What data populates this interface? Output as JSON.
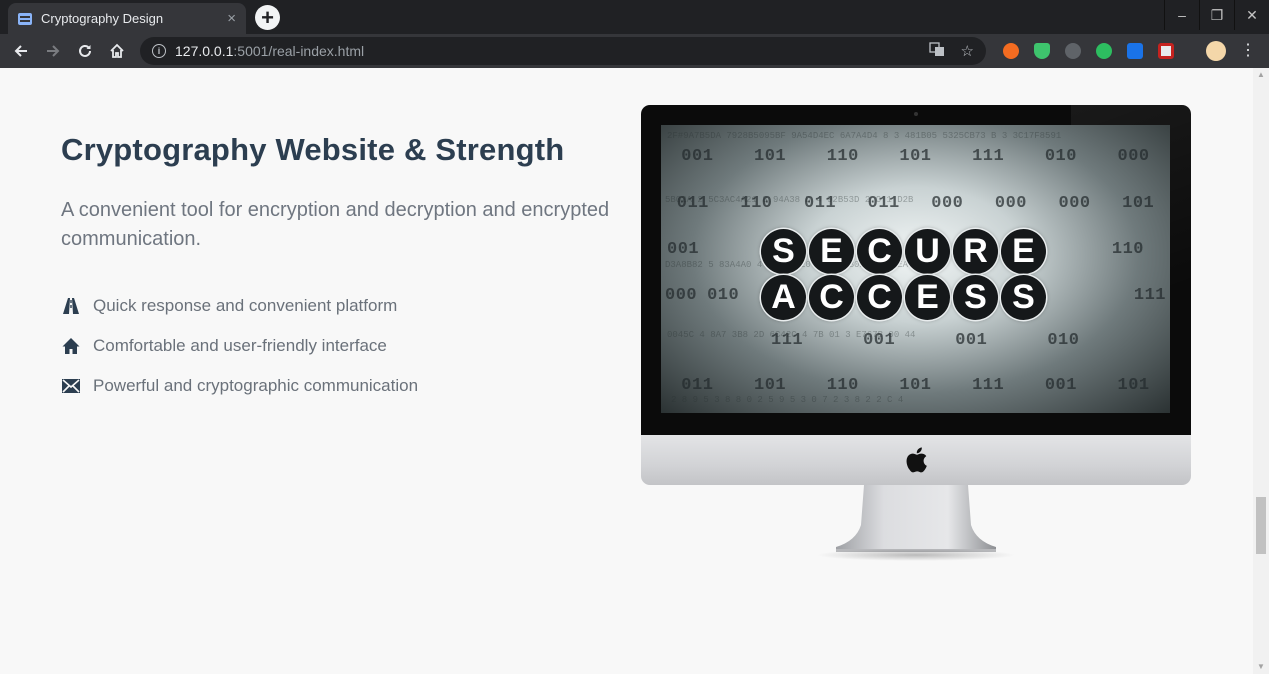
{
  "browser": {
    "tab_title": "Cryptography Design",
    "tab_close": "×",
    "new_tab": "+",
    "url_host": "127.0.0.1",
    "url_rest": ":5001/real-index.html",
    "window_controls": [
      "–",
      "❐",
      "✕"
    ]
  },
  "page": {
    "heading": "Cryptography Website & Strength",
    "lead": "A convenient tool for encryption and decryption and encrypted communication.",
    "features": [
      {
        "icon": "road-icon",
        "label": "Quick response and convenient platform"
      },
      {
        "icon": "home-icon",
        "label": "Comfortable and user-friendly interface"
      },
      {
        "icon": "envelope-icon",
        "label": "Powerful and cryptographic communication"
      }
    ],
    "hero_image": {
      "line1": [
        "S",
        "E",
        "C",
        "U",
        "R",
        "E"
      ],
      "line2": [
        "A",
        "C",
        "C",
        "E",
        "S",
        "S"
      ],
      "binary_rows": [
        [
          "001",
          "101",
          "110",
          "101",
          "111",
          "010",
          "000"
        ],
        [
          "011",
          "110",
          "011",
          "011",
          "000",
          "000",
          "000",
          "101"
        ],
        [
          "001",
          "110"
        ],
        [
          "000",
          "010",
          "111"
        ],
        [
          "111",
          "001",
          "001",
          "010"
        ],
        [
          "011",
          "101",
          "110",
          "101",
          "111",
          "001",
          "101"
        ]
      ]
    }
  },
  "colors": {
    "heading": "#2c3e50",
    "text": "#6f7680",
    "icon": "#2c3e50",
    "page_bg": "#f8f8f8",
    "chrome_dark": "#202124",
    "chrome_toolbar": "#35363a"
  }
}
